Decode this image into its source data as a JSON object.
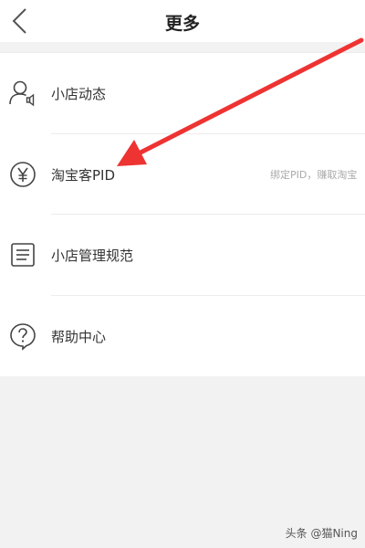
{
  "header": {
    "title": "更多",
    "back_icon": "chevron-left-icon"
  },
  "menu": {
    "items": [
      {
        "label": "小店动态",
        "icon": "user-speaker-icon",
        "hint": ""
      },
      {
        "label": "淘宝客PID",
        "icon": "yen-circle-icon",
        "hint": "绑定PID，赚取淘宝"
      },
      {
        "label": "小店管理规范",
        "icon": "document-list-icon",
        "hint": ""
      },
      {
        "label": "帮助中心",
        "icon": "help-question-icon",
        "hint": ""
      }
    ]
  },
  "annotation": {
    "color": "#ee3333"
  },
  "watermark": "头条 @猫Ning",
  "colors": {
    "background": "#f2f2f2",
    "surface": "#ffffff",
    "text": "#333333",
    "hint": "#aaaaaa",
    "arrow": "#ee3333"
  }
}
